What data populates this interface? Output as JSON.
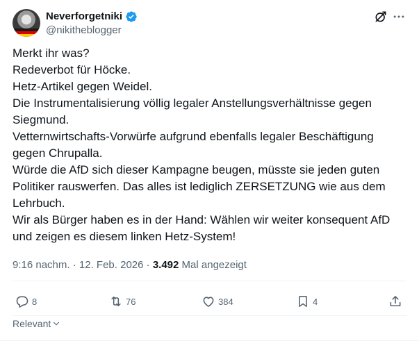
{
  "author": {
    "display_name": "Neverforgetniki",
    "handle": "@nikitheblogger",
    "verified": true
  },
  "tweet": {
    "lines": [
      "Merkt ihr was?",
      "Redeverbot für Höcke.",
      "Hetz-Artikel gegen Weidel.",
      "Die Instrumentalisierung völlig legaler Anstellungsverhältnisse gegen",
      "Siegmund.",
      "Vetternwirtschafts-Vorwürfe aufgrund ebenfalls legaler Beschäftigung",
      "gegen Chrupalla.",
      "Würde die AfD sich dieser Kampagne beugen, müsste sie jeden guten",
      "Politiker rauswerfen. Das alles ist lediglich ZERSETZUNG wie aus dem",
      "Lehrbuch.",
      "Wir als Bürger haben es in der Hand: Wählen wir weiter konsequent AfD",
      "und zeigen es diesem linken Hetz-System!"
    ]
  },
  "meta": {
    "time": "9:16 nachm.",
    "separator": " · ",
    "date": "12. Feb. 2026",
    "views_count": "3.492",
    "views_label": " Mal angezeigt"
  },
  "actions": {
    "replies": "8",
    "reposts": "76",
    "likes": "384",
    "bookmarks": "4"
  },
  "sort": {
    "label": "Relevant"
  },
  "colors": {
    "text": "#0f1419",
    "secondary": "#536471",
    "verified": "#1d9bf0",
    "divider": "#eff3f4"
  },
  "icons": {
    "verified": "verified-badge-icon",
    "grok": "grok-icon",
    "more": "more-icon",
    "reply": "reply-icon",
    "repost": "repost-icon",
    "like": "heart-icon",
    "bookmark": "bookmark-icon",
    "share": "share-icon",
    "chevron": "chevron-down-icon"
  }
}
